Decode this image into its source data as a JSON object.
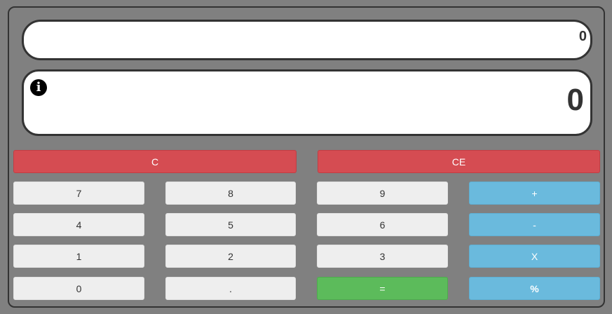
{
  "display": {
    "expression": "0",
    "result": "0",
    "info_icon": "info-circle-icon"
  },
  "buttons": {
    "clear": "C",
    "clear_entry": "CE",
    "seven": "7",
    "eight": "8",
    "nine": "9",
    "plus": "+",
    "four": "4",
    "five": "5",
    "six": "6",
    "minus": "-",
    "one": "1",
    "two": "2",
    "three": "3",
    "multiply": "X",
    "zero": "0",
    "decimal": ".",
    "equals": "=",
    "percent": "%"
  },
  "colors": {
    "background": "#808080",
    "clear_buttons": "#d54c52",
    "operator_buttons": "#6abadd",
    "equals_button": "#5cbb5b",
    "number_buttons": "#eeeeee"
  }
}
